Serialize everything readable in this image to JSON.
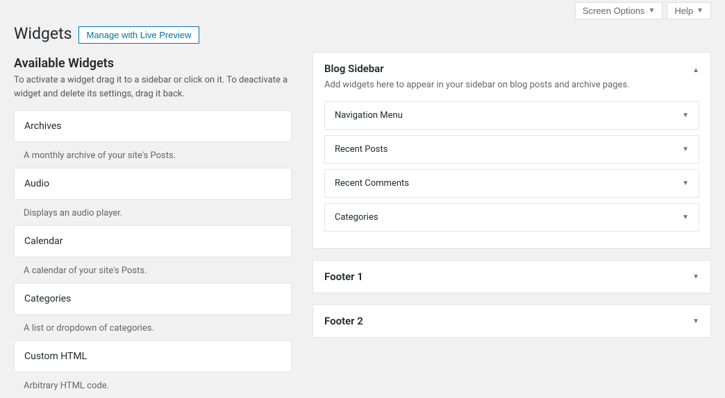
{
  "topbar": {
    "screen_options": "Screen Options",
    "help": "Help"
  },
  "header": {
    "title": "Widgets",
    "live_preview_label": "Manage with Live Preview"
  },
  "available": {
    "title": "Available Widgets",
    "subtitle": "To activate a widget drag it to a sidebar or click on it. To deactivate a widget and delete its settings, drag it back.",
    "items": [
      {
        "name": "Archives",
        "desc": "A monthly archive of your site's Posts."
      },
      {
        "name": "Audio",
        "desc": "Displays an audio player."
      },
      {
        "name": "Calendar",
        "desc": "A calendar of your site's Posts."
      },
      {
        "name": "Categories",
        "desc": "A list or dropdown of categories."
      },
      {
        "name": "Custom HTML",
        "desc": "Arbitrary HTML code."
      }
    ]
  },
  "areas": {
    "blog_sidebar": {
      "title": "Blog Sidebar",
      "desc": "Add widgets here to appear in your sidebar on blog posts and archive pages.",
      "widgets": [
        {
          "name": "Navigation Menu"
        },
        {
          "name": "Recent Posts"
        },
        {
          "name": "Recent Comments"
        },
        {
          "name": "Categories"
        }
      ]
    },
    "footer1": {
      "title": "Footer 1"
    },
    "footer2": {
      "title": "Footer 2"
    }
  }
}
